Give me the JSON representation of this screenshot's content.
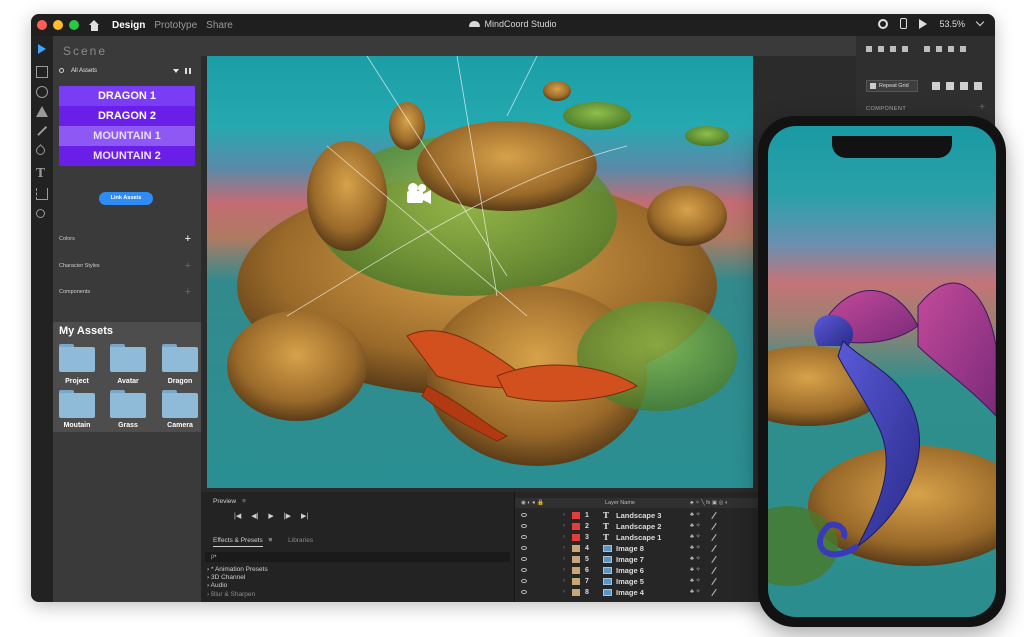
{
  "window": {
    "title": "MindCoord Studio",
    "tabs": [
      {
        "label": "Design",
        "active": true
      },
      {
        "label": "Prototype",
        "active": false
      },
      {
        "label": "Share",
        "active": false
      }
    ],
    "zoom": "53.5%"
  },
  "scene": {
    "title": "Scene",
    "filter_label": "All Assets",
    "assets": [
      "DRAGON 1",
      "DRAGON 2",
      "MOUNTAIN 1",
      "MOUNTAIN 2"
    ],
    "link_button": "Link Assets",
    "sections": [
      "Colors",
      "Character Styles",
      "Components"
    ]
  },
  "my_assets": {
    "title": "My Assets",
    "folders": [
      "Project",
      "Avatar",
      "Dragon",
      "Moutain",
      "Grass",
      "Camera"
    ]
  },
  "preview_panel": {
    "title": "Preview",
    "tabs": [
      "Effects & Presets",
      "Libraries"
    ],
    "search_placeholder": "ρ•",
    "effects": [
      "* Animation Presets",
      "3D Channel",
      "Audio",
      "Blur & Sharpen"
    ]
  },
  "layers_panel": {
    "header": "Layer Name",
    "layers": [
      {
        "num": "1",
        "name": "Landscape 3",
        "type": "text",
        "color": "#e23c3c"
      },
      {
        "num": "2",
        "name": "Landscape 2",
        "type": "text",
        "color": "#e23c3c"
      },
      {
        "num": "3",
        "name": "Landscape 1",
        "type": "text",
        "color": "#e23c3c"
      },
      {
        "num": "4",
        "name": "Image 8",
        "type": "image",
        "color": "#c7a77a"
      },
      {
        "num": "5",
        "name": "Image 7",
        "type": "image",
        "color": "#c7a77a"
      },
      {
        "num": "6",
        "name": "Image 6",
        "type": "image",
        "color": "#c7a77a"
      },
      {
        "num": "7",
        "name": "Image 5",
        "type": "image",
        "color": "#c7a77a"
      },
      {
        "num": "8",
        "name": "Image 4",
        "type": "image",
        "color": "#c7a77a"
      }
    ]
  },
  "properties_panel": {
    "repeat_grid": "Repeat Grid",
    "component_label": "COMPONENT"
  },
  "colors": {
    "accent": "#2f8bf5",
    "asset_purple": "#6a1fe8"
  }
}
